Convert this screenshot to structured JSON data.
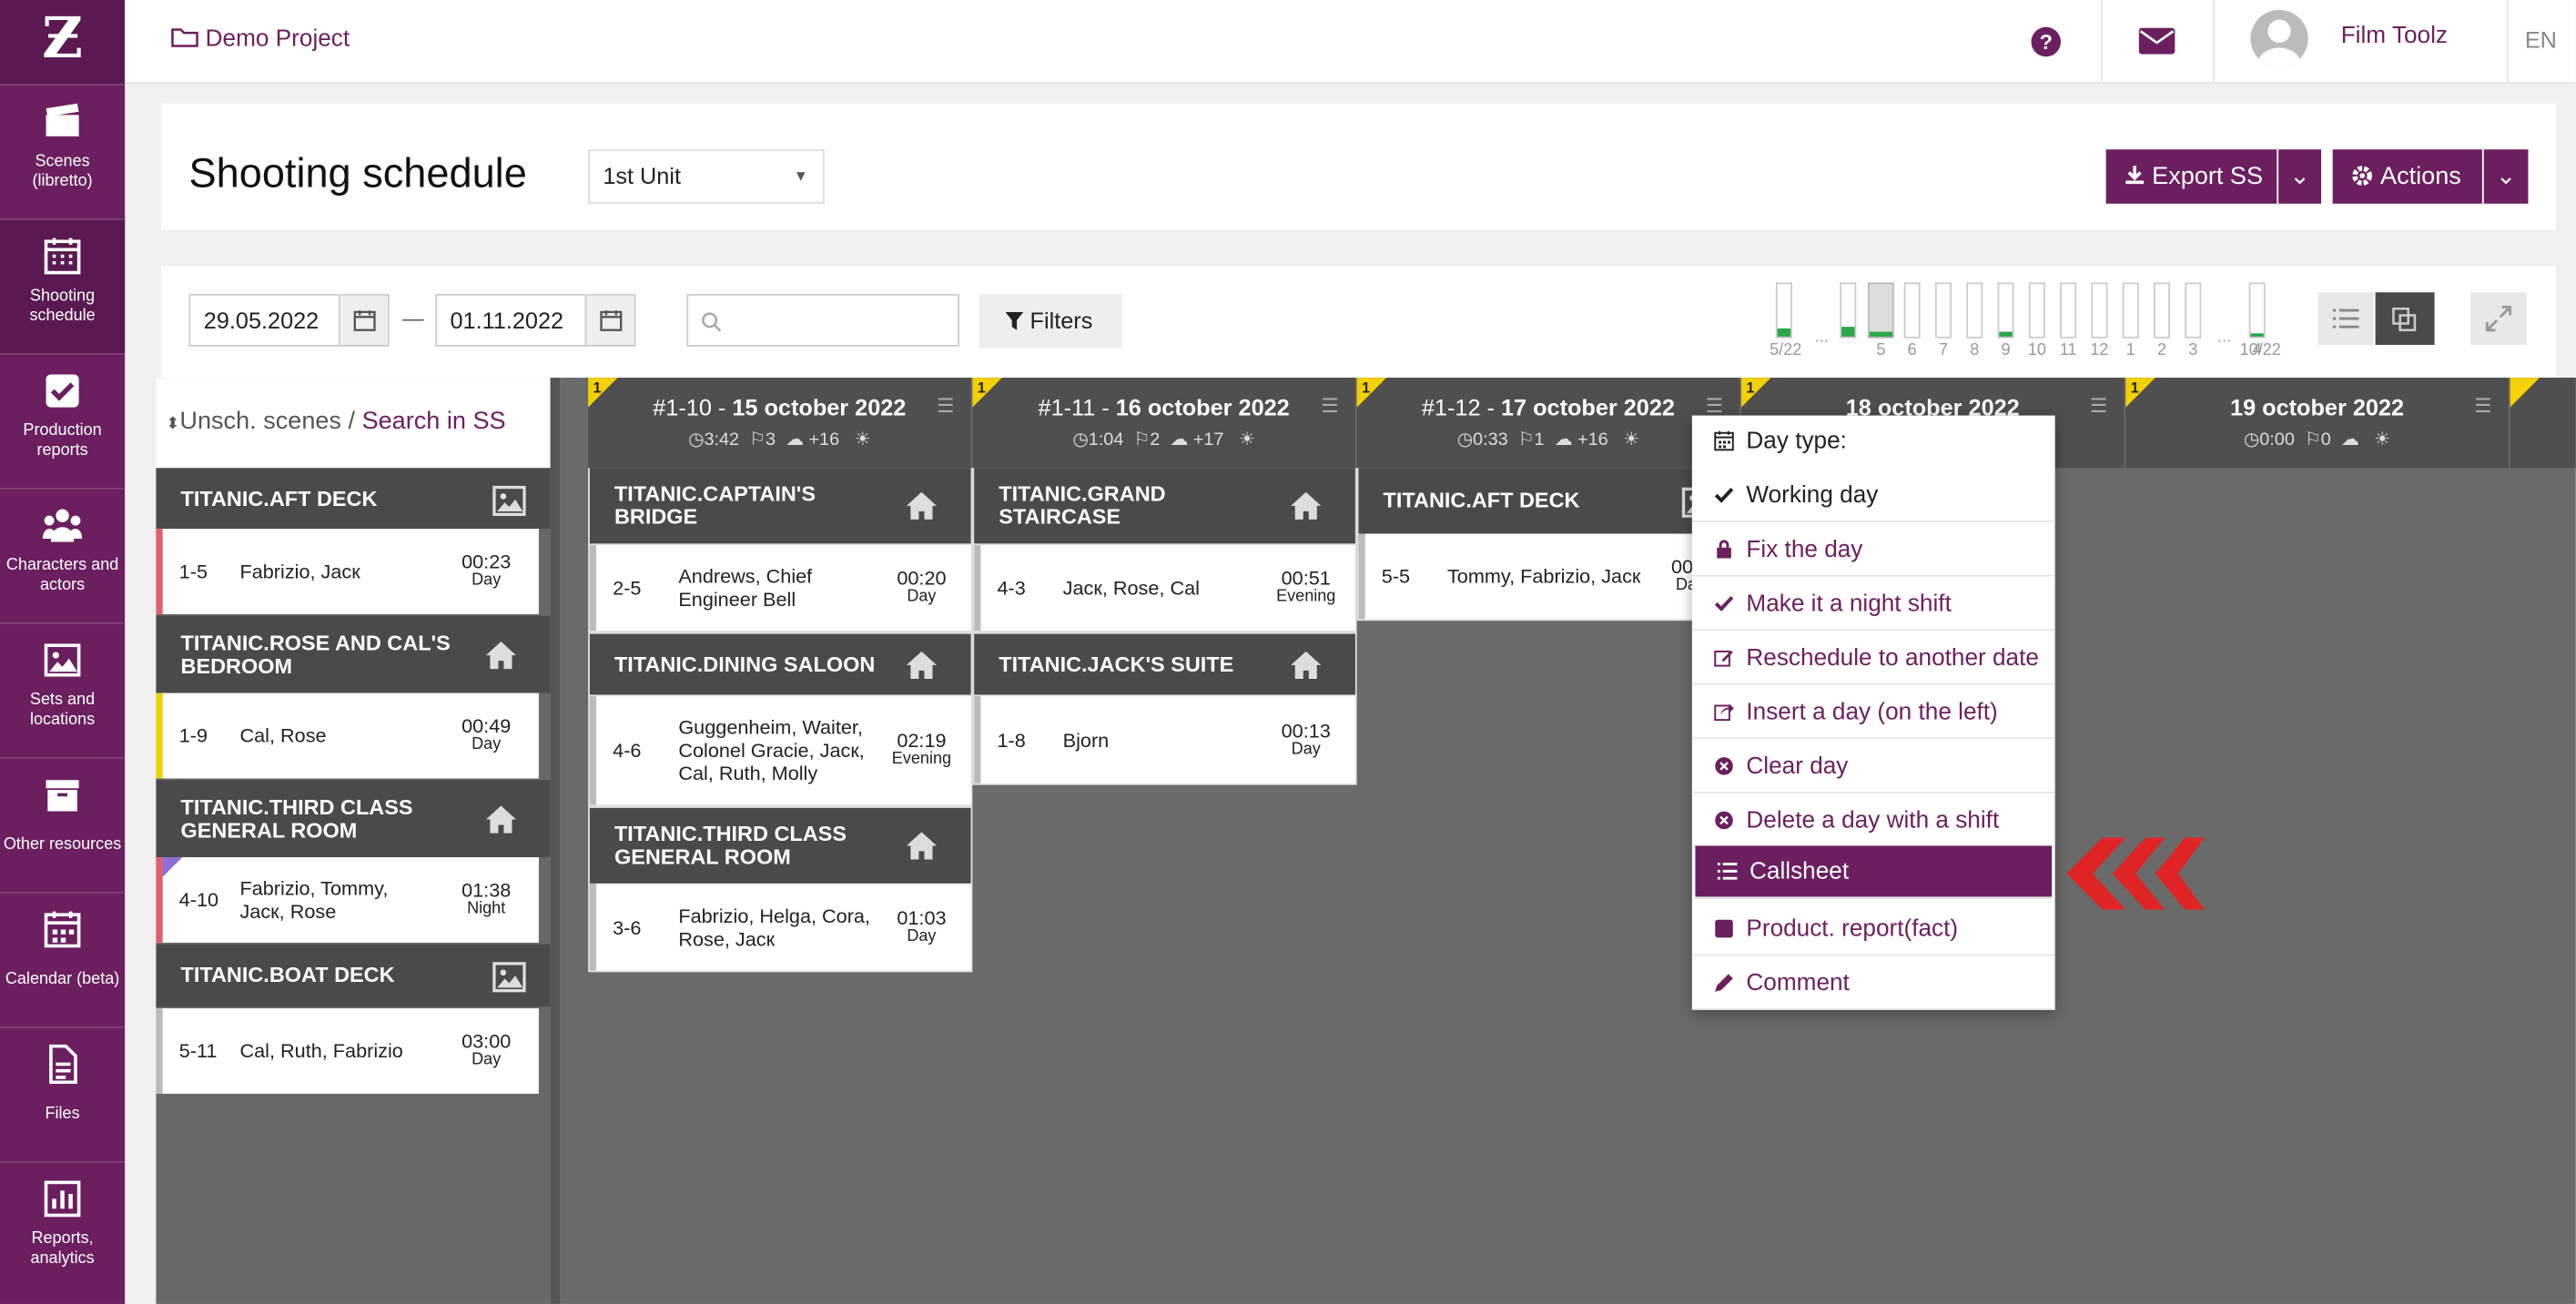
{
  "app": {
    "logo": "Ƶ",
    "project": "Demo Project",
    "user": "Film Toolz",
    "lang": "EN"
  },
  "sidebar": [
    {
      "label": "Scenes (libretto)",
      "icon": "clapper-icon"
    },
    {
      "label": "Shooting schedule",
      "icon": "calendar-grid-icon"
    },
    {
      "label": "Production reports",
      "icon": "checkbox-icon"
    },
    {
      "label": "Characters and actors",
      "icon": "people-icon"
    },
    {
      "label": "Sets and locations",
      "icon": "image-icon"
    },
    {
      "label": "Other resources",
      "icon": "archive-icon"
    },
    {
      "label": "Calendar (beta)",
      "icon": "calendar-icon"
    },
    {
      "label": "Files",
      "icon": "file-icon"
    },
    {
      "label": "Reports, analytics",
      "icon": "chart-icon"
    }
  ],
  "header": {
    "title": "Shooting schedule",
    "unit": "1st Unit",
    "export": "Export SS",
    "actions": "Actions"
  },
  "filters": {
    "date_from": "29.05.2022",
    "date_dash": "—",
    "date_to": "01.11.2022",
    "filters": "Filters"
  },
  "timeline": {
    "start": "5/22",
    "dots1": "...",
    "labels": [
      "5",
      "6",
      "7",
      "8",
      "9",
      "10",
      "11",
      "12",
      "1",
      "2",
      "3",
      "4"
    ],
    "dots2": "...",
    "end": "10/22",
    "fills": [
      0.15,
      0.2,
      0.08,
      0,
      0,
      0,
      0.1,
      0,
      0,
      0,
      0,
      0,
      0,
      0.05
    ]
  },
  "left": {
    "unsched": "Unsch. scenes",
    "slash": "/",
    "search": "Search in SS",
    "groups": [
      {
        "loc": "TITANIC.AFT DECK",
        "icon": "image-icon",
        "scenes": [
          {
            "n": "1-5",
            "c": "Fabrizio, Jacк",
            "t": "00:23",
            "p": "Day",
            "color": "#e35d6a"
          }
        ]
      },
      {
        "loc": "TITANIC.ROSE AND CAL'S BEDROOM",
        "icon": "home-icon",
        "scenes": [
          {
            "n": "1-9",
            "c": "Cal, Rose",
            "t": "00:49",
            "p": "Day",
            "color": "#f0d000"
          }
        ]
      },
      {
        "loc": "TITANIC.THIRD CLASS GENERAL ROOM",
        "icon": "home-icon",
        "scenes": [
          {
            "n": "4-10",
            "c": "Fabrizio, Tommy, Jacк, Rose",
            "t": "01:38",
            "p": "Night",
            "color": "#e35d6a"
          }
        ]
      },
      {
        "loc": "TITANIC.BOAT DECK",
        "icon": "image-icon",
        "scenes": [
          {
            "n": "5-11",
            "c": "Cal, Ruth, Fabrizio",
            "t": "03:00",
            "p": "Day",
            "color": "#bbb"
          }
        ]
      }
    ]
  },
  "days": [
    {
      "flag": "1",
      "num": "#1-10 - ",
      "date": "15 october 2022",
      "dur": "3:42",
      "cnt": "3",
      "temp": "+16",
      "groups": [
        {
          "loc": "TITANIC.CAPTAIN'S BRIDGE",
          "icon": "home-icon",
          "scenes": [
            {
              "n": "2-5",
              "c": "Andrews, Chief Engineer Bell",
              "t": "00:20",
              "p": "Day"
            }
          ]
        },
        {
          "loc": "TITANIC.DINING SALOON",
          "icon": "home-icon",
          "scenes": [
            {
              "n": "4-6",
              "c": "Guggenheim, Waiter, Colonel Gracie, Jacк, Cal, Ruth, Molly",
              "t": "02:19",
              "p": "Evening"
            }
          ]
        },
        {
          "loc": "TITANIC.THIRD CLASS GENERAL ROOM",
          "icon": "home-icon",
          "scenes": [
            {
              "n": "3-6",
              "c": "Fabrizio, Helga, Cora, Rose, Jacк",
              "t": "01:03",
              "p": "Day"
            }
          ]
        }
      ]
    },
    {
      "flag": "1",
      "num": "#1-11 - ",
      "date": "16 october 2022",
      "dur": "1:04",
      "cnt": "2",
      "temp": "+17",
      "groups": [
        {
          "loc": "TITANIC.GRAND STAIRCASE",
          "icon": "home-icon",
          "scenes": [
            {
              "n": "4-3",
              "c": "Jacк, Rose, Cal",
              "t": "00:51",
              "p": "Evening"
            }
          ]
        },
        {
          "loc": "TITANIC.JACK'S SUITE",
          "icon": "home-icon",
          "scenes": [
            {
              "n": "1-8",
              "c": "Bjorn",
              "t": "00:13",
              "p": "Day"
            }
          ]
        }
      ]
    },
    {
      "flag": "1",
      "num": "#1-12 - ",
      "date": "17 october 2022",
      "dur": "0:33",
      "cnt": "1",
      "temp": "+16",
      "groups": [
        {
          "loc": "TITANIC.AFT DECK",
          "icon": "image-icon",
          "scenes": [
            {
              "n": "5-5",
              "c": "Tommy, Fabrizio, Jacк",
              "t": "00:3",
              "p": "Day"
            }
          ]
        }
      ]
    },
    {
      "flag": "1",
      "num": "",
      "date": "18 october 2022",
      "dur": "",
      "cnt": "",
      "temp": "",
      "groups": []
    },
    {
      "flag": "1",
      "num": "",
      "date": "19 october 2022",
      "dur": "0:00",
      "cnt": "0",
      "temp": "",
      "groups": []
    }
  ],
  "menu": {
    "items": [
      {
        "label": "Day type:",
        "icon": "calendar-icon",
        "type": "header"
      },
      {
        "label": "Working day",
        "icon": "check-icon",
        "type": "plain"
      },
      {
        "label": "Fix the day",
        "icon": "lock-icon",
        "type": "link"
      },
      {
        "label": "Make it a night shift",
        "icon": "check-icon",
        "type": "link"
      },
      {
        "label": "Reschedule to another date",
        "icon": "edit-icon",
        "type": "link"
      },
      {
        "label": "Insert a day (on the left)",
        "icon": "share-icon",
        "type": "link"
      },
      {
        "label": "Clear day",
        "icon": "circle-x-icon",
        "type": "link"
      },
      {
        "label": "Delete a day with a shift",
        "icon": "circle-x-icon",
        "type": "link"
      },
      {
        "label": "Callsheet",
        "icon": "list-icon",
        "type": "active"
      },
      {
        "label": "Product. report(fact)",
        "icon": "checkbox-icon",
        "type": "link"
      },
      {
        "label": "Comment",
        "icon": "pencil-icon",
        "type": "link"
      }
    ]
  },
  "colors": {
    "brand": "#6b1f5e",
    "arrow": "#e02424",
    "flag": "#f5d000"
  }
}
